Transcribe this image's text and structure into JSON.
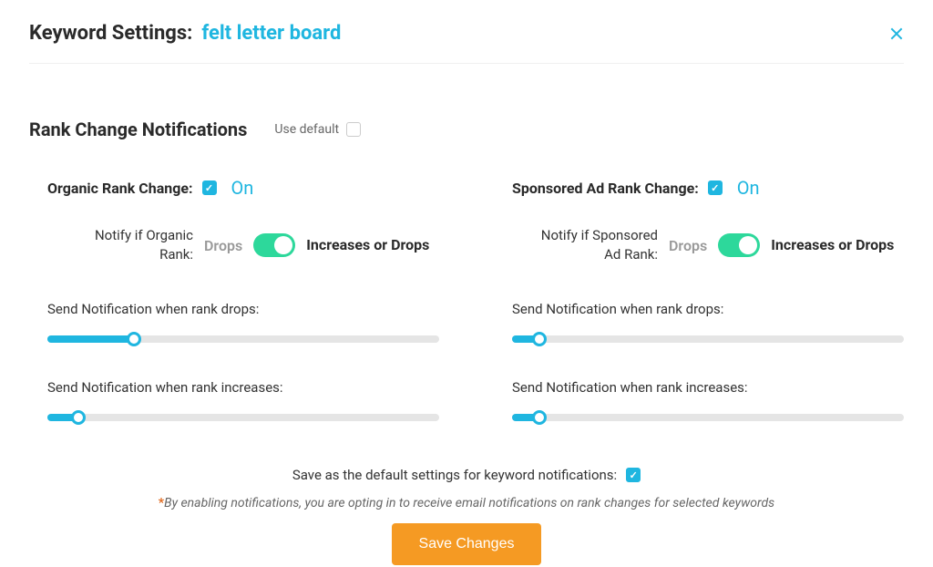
{
  "header": {
    "title": "Keyword Settings:",
    "keyword": "felt letter board"
  },
  "section": {
    "title": "Rank Change Notifications",
    "use_default_label": "Use default"
  },
  "organic": {
    "title": "Organic Rank Change:",
    "status": "On",
    "notify_label": "Notify if Organic Rank:",
    "drops_label": "Drops",
    "incdrop_label": "Increases or Drops",
    "drop_slider_label": "Send Notification when rank drops:",
    "drop_slider_value": 22,
    "inc_slider_label": "Send Notification when rank increases:",
    "inc_slider_value": 8
  },
  "sponsored": {
    "title": "Sponsored Ad Rank Change:",
    "status": "On",
    "notify_label": "Notify if Sponsored Ad Rank:",
    "drops_label": "Drops",
    "incdrop_label": "Increases or Drops",
    "drop_slider_label": "Send Notification when rank drops:",
    "drop_slider_value": 7,
    "inc_slider_label": "Send Notification when rank increases:",
    "inc_slider_value": 7
  },
  "footer": {
    "save_default_label": "Save as the default settings for keyword notifications:",
    "disclaimer": "By enabling notifications, you are opting in to receive email notifications on rank changes for selected keywords",
    "save_button": "Save Changes"
  },
  "colors": {
    "accent": "#1fb6e0",
    "toggle": "#2dd89b",
    "button": "#f59a23"
  }
}
